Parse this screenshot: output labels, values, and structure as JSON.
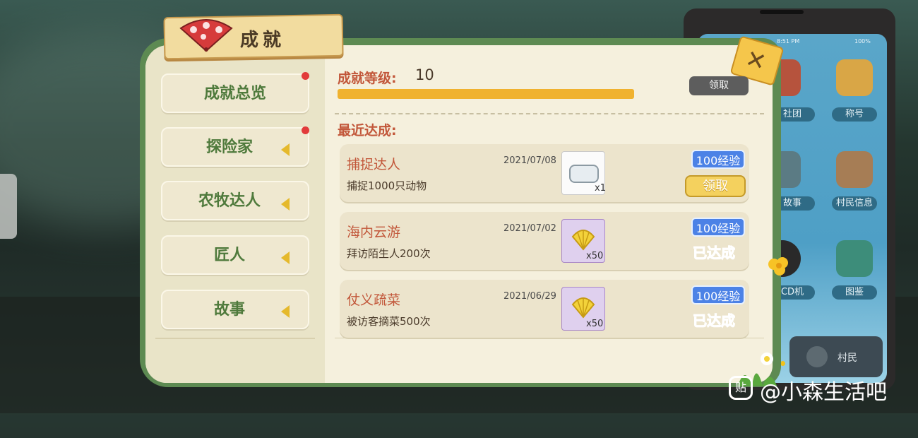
{
  "title": "成就",
  "sidebar": {
    "items": [
      {
        "label": "成就总览",
        "badge": true,
        "arrow": false
      },
      {
        "label": "探险家",
        "badge": true,
        "arrow": true
      },
      {
        "label": "农牧达人",
        "badge": false,
        "arrow": true
      },
      {
        "label": "匠人",
        "badge": false,
        "arrow": true
      },
      {
        "label": "故事",
        "badge": false,
        "arrow": true
      }
    ]
  },
  "level": {
    "label": "成就等级:",
    "value": "10",
    "progress": 1.0
  },
  "claim_button": "领取",
  "recent_label": "最近达成:",
  "achievements": [
    {
      "name": "捕捉达人",
      "desc": "捕捉1000只动物",
      "date": "2021/07/08",
      "reward_icon": "pebble-icon",
      "qty": "x1",
      "exp": "100经验",
      "status": "领取"
    },
    {
      "name": "海内云游",
      "desc": "拜访陌生人200次",
      "date": "2021/07/02",
      "reward_icon": "shell-icon",
      "qty": "x50",
      "exp": "100经验",
      "status": "已达成"
    },
    {
      "name": "仗义疏菜",
      "desc": "被访客摘菜500次",
      "date": "2021/06/29",
      "reward_icon": "shell-icon",
      "qty": "x50",
      "exp": "100经验",
      "status": "已达成"
    }
  ],
  "phone": {
    "time": "8:51 PM",
    "battery": "100%",
    "apps": [
      "社团",
      "称号",
      "故事",
      "村民信息",
      "CD机",
      "图鉴"
    ],
    "dock_label": "村民"
  },
  "watermark": {
    "icon": "贴",
    "text": "@小森生活吧"
  },
  "colors": {
    "accent_red": "#c2573a",
    "frame_green": "#5d8a52",
    "exp_blue": "#4c82e6",
    "done_red": "#e73a36",
    "bar_yellow": "#f0b22f"
  }
}
